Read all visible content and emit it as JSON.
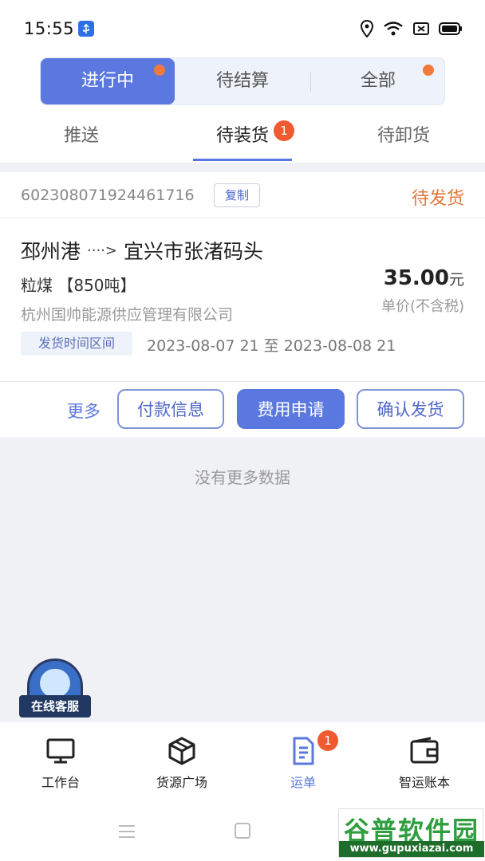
{
  "status_bar": {
    "time": "15:55"
  },
  "segments": [
    {
      "label": "进行中",
      "active": true,
      "dot": true
    },
    {
      "label": "待结算",
      "active": false,
      "dot": false
    },
    {
      "label": "全部",
      "active": false,
      "dot": true
    }
  ],
  "tabs": [
    {
      "label": "推送"
    },
    {
      "label": "待装货",
      "badge": "1"
    },
    {
      "label": "待卸货"
    }
  ],
  "order": {
    "number": "602308071924461716",
    "copy_label": "复制",
    "status": "待发货",
    "from": "邳州港",
    "arrow": "····>",
    "to": "宜兴市张渚码头",
    "goods": "粒煤 【850吨】",
    "price": "35.00",
    "price_unit": "元",
    "price_note": "单价(不含税)",
    "company": "杭州国帅能源供应管理有限公司",
    "time_tag": "发货时间区间",
    "time_range": "2023-08-07 21 至 2023-08-08 21",
    "actions": {
      "more": "更多",
      "payment_info": "付款信息",
      "fee_apply": "费用申请",
      "confirm_ship": "确认发货"
    }
  },
  "no_more_text": "没有更多数据",
  "customer_service": "在线客服",
  "bottom_nav": [
    {
      "label": "工作台",
      "icon": "monitor-icon"
    },
    {
      "label": "货源广场",
      "icon": "box-icon"
    },
    {
      "label": "运单",
      "icon": "document-icon",
      "badge": "1",
      "active": true
    },
    {
      "label": "智运账本",
      "icon": "wallet-icon"
    }
  ],
  "watermark": {
    "title": "谷普软件园",
    "url": "www.gupuxiazai.com"
  },
  "colors": {
    "accent": "#5b78e0",
    "status_orange": "#e0763a",
    "badge_red": "#ef5a30"
  }
}
